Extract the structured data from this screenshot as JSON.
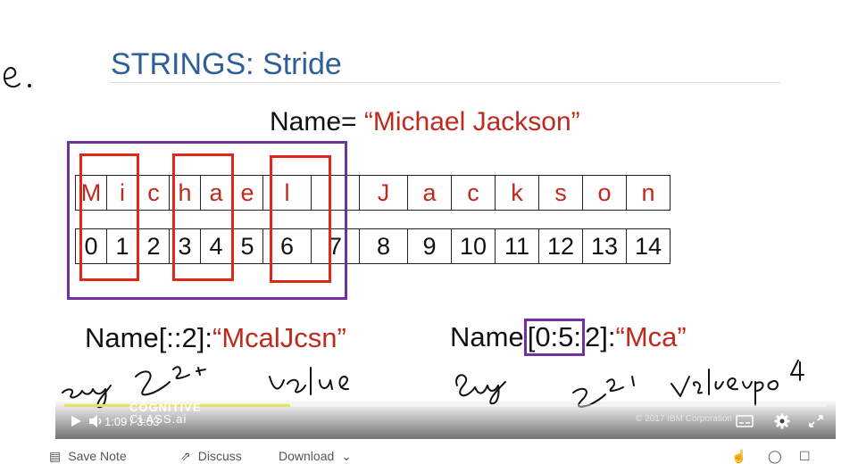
{
  "slide": {
    "title": "STRINGS: Stride",
    "name_label": "Name=",
    "name_value": "“Michael Jackson”",
    "chars": [
      "M",
      "i",
      "c",
      "h",
      "a",
      "e",
      "l",
      "",
      "J",
      "a",
      "c",
      "k",
      "s",
      "o",
      "n"
    ],
    "indices": [
      "0",
      "1",
      "2",
      "3",
      "4",
      "5",
      "6",
      "7",
      "8",
      "9",
      "10",
      "11",
      "12",
      "13",
      "14"
    ],
    "example1_label": "Name[::2]:",
    "example1_value": "“McalJcsn”",
    "example2_prefix": "Name",
    "example2_slice": "[0:5:",
    "example2_suffix": "2]:",
    "example2_value": "“Mca”",
    "copyright": "© 2017 IBM Corporation",
    "logo": [
      "COGNITIVE",
      "CLASS.ai"
    ]
  },
  "player": {
    "time": "1:09 / 3:53",
    "progress_fraction": 0.296,
    "accent": "#e8e45a",
    "icons": [
      "play-icon",
      "volume-icon",
      "captions-icon",
      "settings-icon",
      "fullscreen-icon"
    ]
  },
  "toolbar": {
    "save_note": "Save Note",
    "discuss": "Discuss",
    "download": "Download"
  },
  "colors": {
    "title": "#2e5e9a",
    "red_text": "#c0291d",
    "red_box": "#e0271a",
    "purple_box": "#7030a0"
  }
}
